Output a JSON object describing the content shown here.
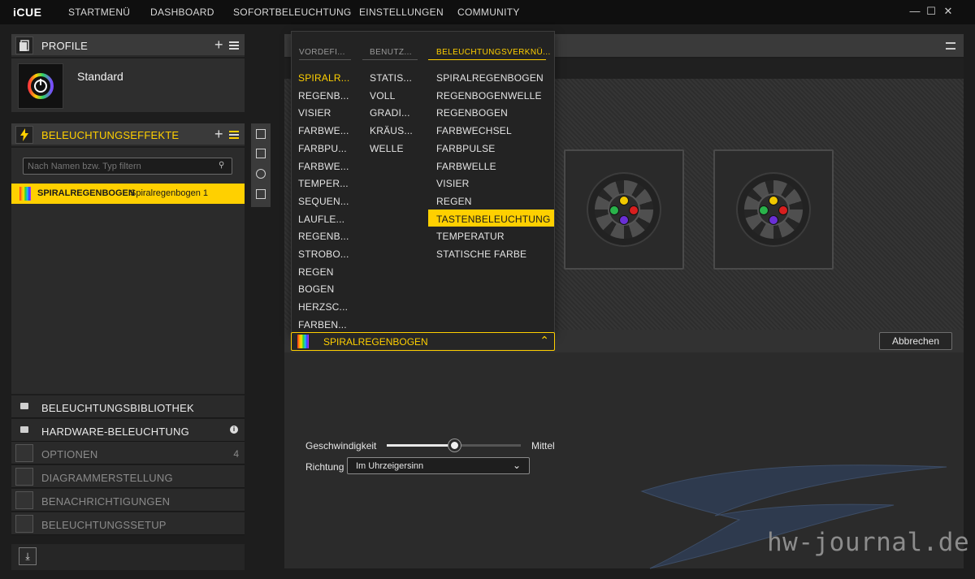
{
  "app": {
    "logo": "iCUE"
  },
  "nav": [
    "STARTMENÜ",
    "DASHBOARD",
    "SOFORTBELEUCHTUNG",
    "EINSTELLUNGEN",
    "COMMUNITY"
  ],
  "window_controls": {
    "minimize": "—",
    "maximize": "☐",
    "close": "✕"
  },
  "profile": {
    "header": "PROFILE",
    "name": "Standard"
  },
  "effects": {
    "header": "BELEUCHTUNGSEFFEKTE",
    "filter_placeholder": "Nach Namen bzw. Typ filtern",
    "selected_name": "SPIRALREGENBOGEN",
    "selected_sub": "Spiralregenbogen 1"
  },
  "bottom_menu": [
    {
      "label": "BELEUCHTUNGSBIBLIOTHEK"
    },
    {
      "label": "HARDWARE-BELEUCHTUNG"
    },
    {
      "label": "OPTIONEN",
      "count": "4"
    },
    {
      "label": "DIAGRAMMERSTELLUNG"
    },
    {
      "label": "BENACHRICHTIGUNGEN"
    },
    {
      "label": "BELEUCHTUNGSSETUP"
    }
  ],
  "dropdown": {
    "columns": [
      {
        "header": "VORDEFI...",
        "items": [
          "SPIRALR...",
          "REGENB...",
          "VISIER",
          "FARBWE...",
          "FARBPU...",
          "FARBWE...",
          "TEMPER...",
          "SEQUEN...",
          "LAUFLE...",
          "REGENB...",
          "STROBO...",
          "REGEN",
          "BOGEN",
          "HERZSC...",
          "FARBEN..."
        ]
      },
      {
        "header": "BENUTZ...",
        "items": [
          "STATIS...",
          "VOLL",
          "GRADI...",
          "KRÄUS...",
          "WELLE"
        ]
      },
      {
        "header": "BELEUCHTUNGSVERKNÜ...",
        "items": [
          "SPIRALREGENBOGEN",
          "REGENBOGENWELLE",
          "REGENBOGEN",
          "FARBWECHSEL",
          "FARBPULSE",
          "FARBWELLE",
          "VISIER",
          "REGEN",
          "TASTENBELEUCHTUNG",
          "TEMPERATUR",
          "STATISCHE FARBE"
        ]
      }
    ],
    "selected": "SPIRALREGENBOGEN"
  },
  "actions": {
    "cancel": "Abbrechen"
  },
  "settings": {
    "speed_label": "Geschwindigkeit",
    "speed_value": "Mittel",
    "speed_level": 0.5,
    "direction_label": "Richtung",
    "direction_value": "Im Uhrzeigersinn"
  },
  "watermark": "hw-journal.de",
  "colors": {
    "accent": "#ffd000",
    "led_colors": [
      "#f0c800",
      "#d81e1e",
      "#6a2fd6",
      "#29b34a"
    ]
  },
  "icons": [
    "profile-icon",
    "lightning-icon",
    "search-icon",
    "folder-icon",
    "trash-icon",
    "download-icon",
    "info-icon",
    "chevron-up-icon",
    "chevron-down-icon",
    "menu-icon"
  ]
}
